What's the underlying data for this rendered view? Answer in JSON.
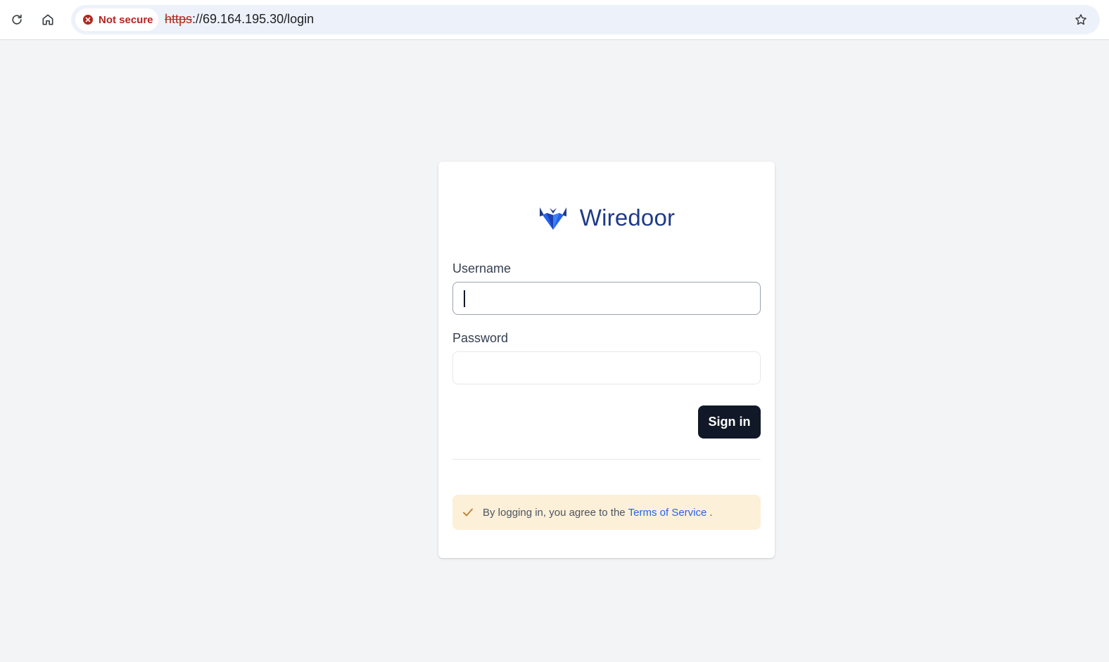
{
  "browser": {
    "security_label": "Not secure",
    "url_scheme": "https",
    "url_rest": "://69.164.195.30/login",
    "icons": [
      "reload-icon",
      "home-icon",
      "not-secure-icon",
      "star-icon"
    ]
  },
  "login": {
    "brand_name": "Wiredoor",
    "username_label": "Username",
    "username_value": "",
    "password_label": "Password",
    "password_value": "",
    "signin_label": "Sign in",
    "notice_prefix": "By logging in, you agree to the",
    "terms_link": "Terms of Service",
    "notice_suffix": "."
  },
  "colors": {
    "brand": "#1e3a8a",
    "button_bg": "#111827",
    "link": "#2563eb",
    "notice_bg": "#fdf0d8",
    "check": "#c2863a",
    "warning": "#b3261e",
    "page_bg": "#f3f4f6"
  }
}
